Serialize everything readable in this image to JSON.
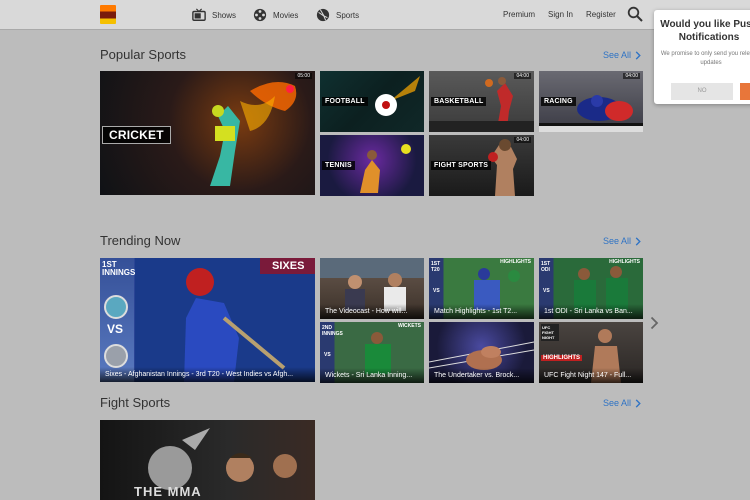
{
  "header": {
    "nav": [
      {
        "label": "Shows",
        "icon": "tv-icon"
      },
      {
        "label": "Movies",
        "icon": "film-reel-icon"
      },
      {
        "label": "Sports",
        "icon": "football-icon"
      }
    ],
    "links": [
      "Premium",
      "Sign In",
      "Register"
    ]
  },
  "push": {
    "title": "Would you like Push Notifications",
    "body": "We promise to only send you relevant updates",
    "no_label": "NO"
  },
  "sections": {
    "popular": {
      "title": "Popular Sports",
      "see_all": "See All"
    },
    "trending": {
      "title": "Trending Now",
      "see_all": "See All"
    },
    "fight": {
      "title": "Fight Sports",
      "see_all": "See All"
    }
  },
  "popular_tiles": [
    {
      "label": "CRICKET",
      "duration": "05:00"
    },
    {
      "label": "FOOTBALL",
      "duration": ""
    },
    {
      "label": "BASKETBALL",
      "duration": "04:00"
    },
    {
      "label": "RACING",
      "duration": "04:00"
    },
    {
      "label": "TENNIS",
      "duration": ""
    },
    {
      "label": "FIGHT SPORTS",
      "duration": "04:00"
    }
  ],
  "trending_tiles": [
    {
      "caption": "Sixes - Afghanistan Innings - 3rd T20 - West Indies vs Afgh...",
      "badge": "SIXES",
      "tag": "1ST INNINGS",
      "vs": "VS"
    },
    {
      "caption": "The Videocast - How will..."
    },
    {
      "caption": "Match Highlights - 1st T2...",
      "badge": "HIGHLIGHTS",
      "tag": "1ST T20",
      "vs": "VS"
    },
    {
      "caption": "1st ODI - Sri Lanka vs Ban...",
      "badge": "HIGHLIGHTS",
      "tag": "1ST ODI",
      "vs": "VS"
    },
    {
      "caption": "Wickets - Sri Lanka Inning...",
      "badge": "WICKETS",
      "tag": "2ND INNINGS",
      "vs": "VS"
    },
    {
      "caption": "The Undertaker vs. Brock..."
    },
    {
      "caption": "UFC Fight Night 147 - Full...",
      "badge": "HIGHLIGHTS",
      "tag": "UFC FIGHT NIGHT"
    }
  ],
  "fight_tiles": [
    {
      "logo_text": "THE MMA"
    }
  ]
}
